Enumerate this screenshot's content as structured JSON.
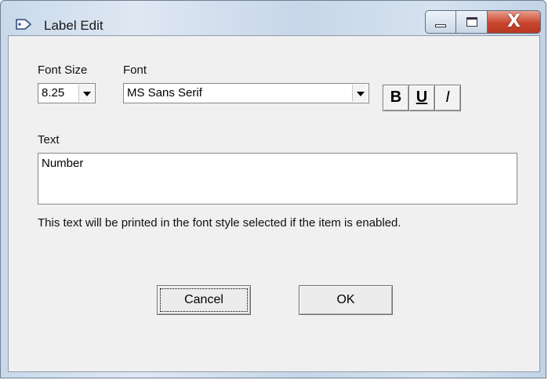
{
  "window": {
    "title": "Label Edit",
    "icons": {
      "app": "label-icon",
      "minimize": "minimize-icon",
      "maximize": "maximize-icon",
      "close": "close-icon"
    },
    "close_glyph": "X"
  },
  "font_size": {
    "label": "Font Size",
    "value": "8.25"
  },
  "font": {
    "label": "Font",
    "value": "MS Sans Serif"
  },
  "format_buttons": {
    "bold": "B",
    "underline": "U",
    "italic": "I"
  },
  "text_field": {
    "label": "Text",
    "value": "Number"
  },
  "hint": "This text will be printed in the font style selected if the item is enabled.",
  "buttons": {
    "cancel": "Cancel",
    "ok": "OK"
  },
  "colors": {
    "close_button": "#c9442d",
    "client_bg": "#f0f0f0"
  }
}
